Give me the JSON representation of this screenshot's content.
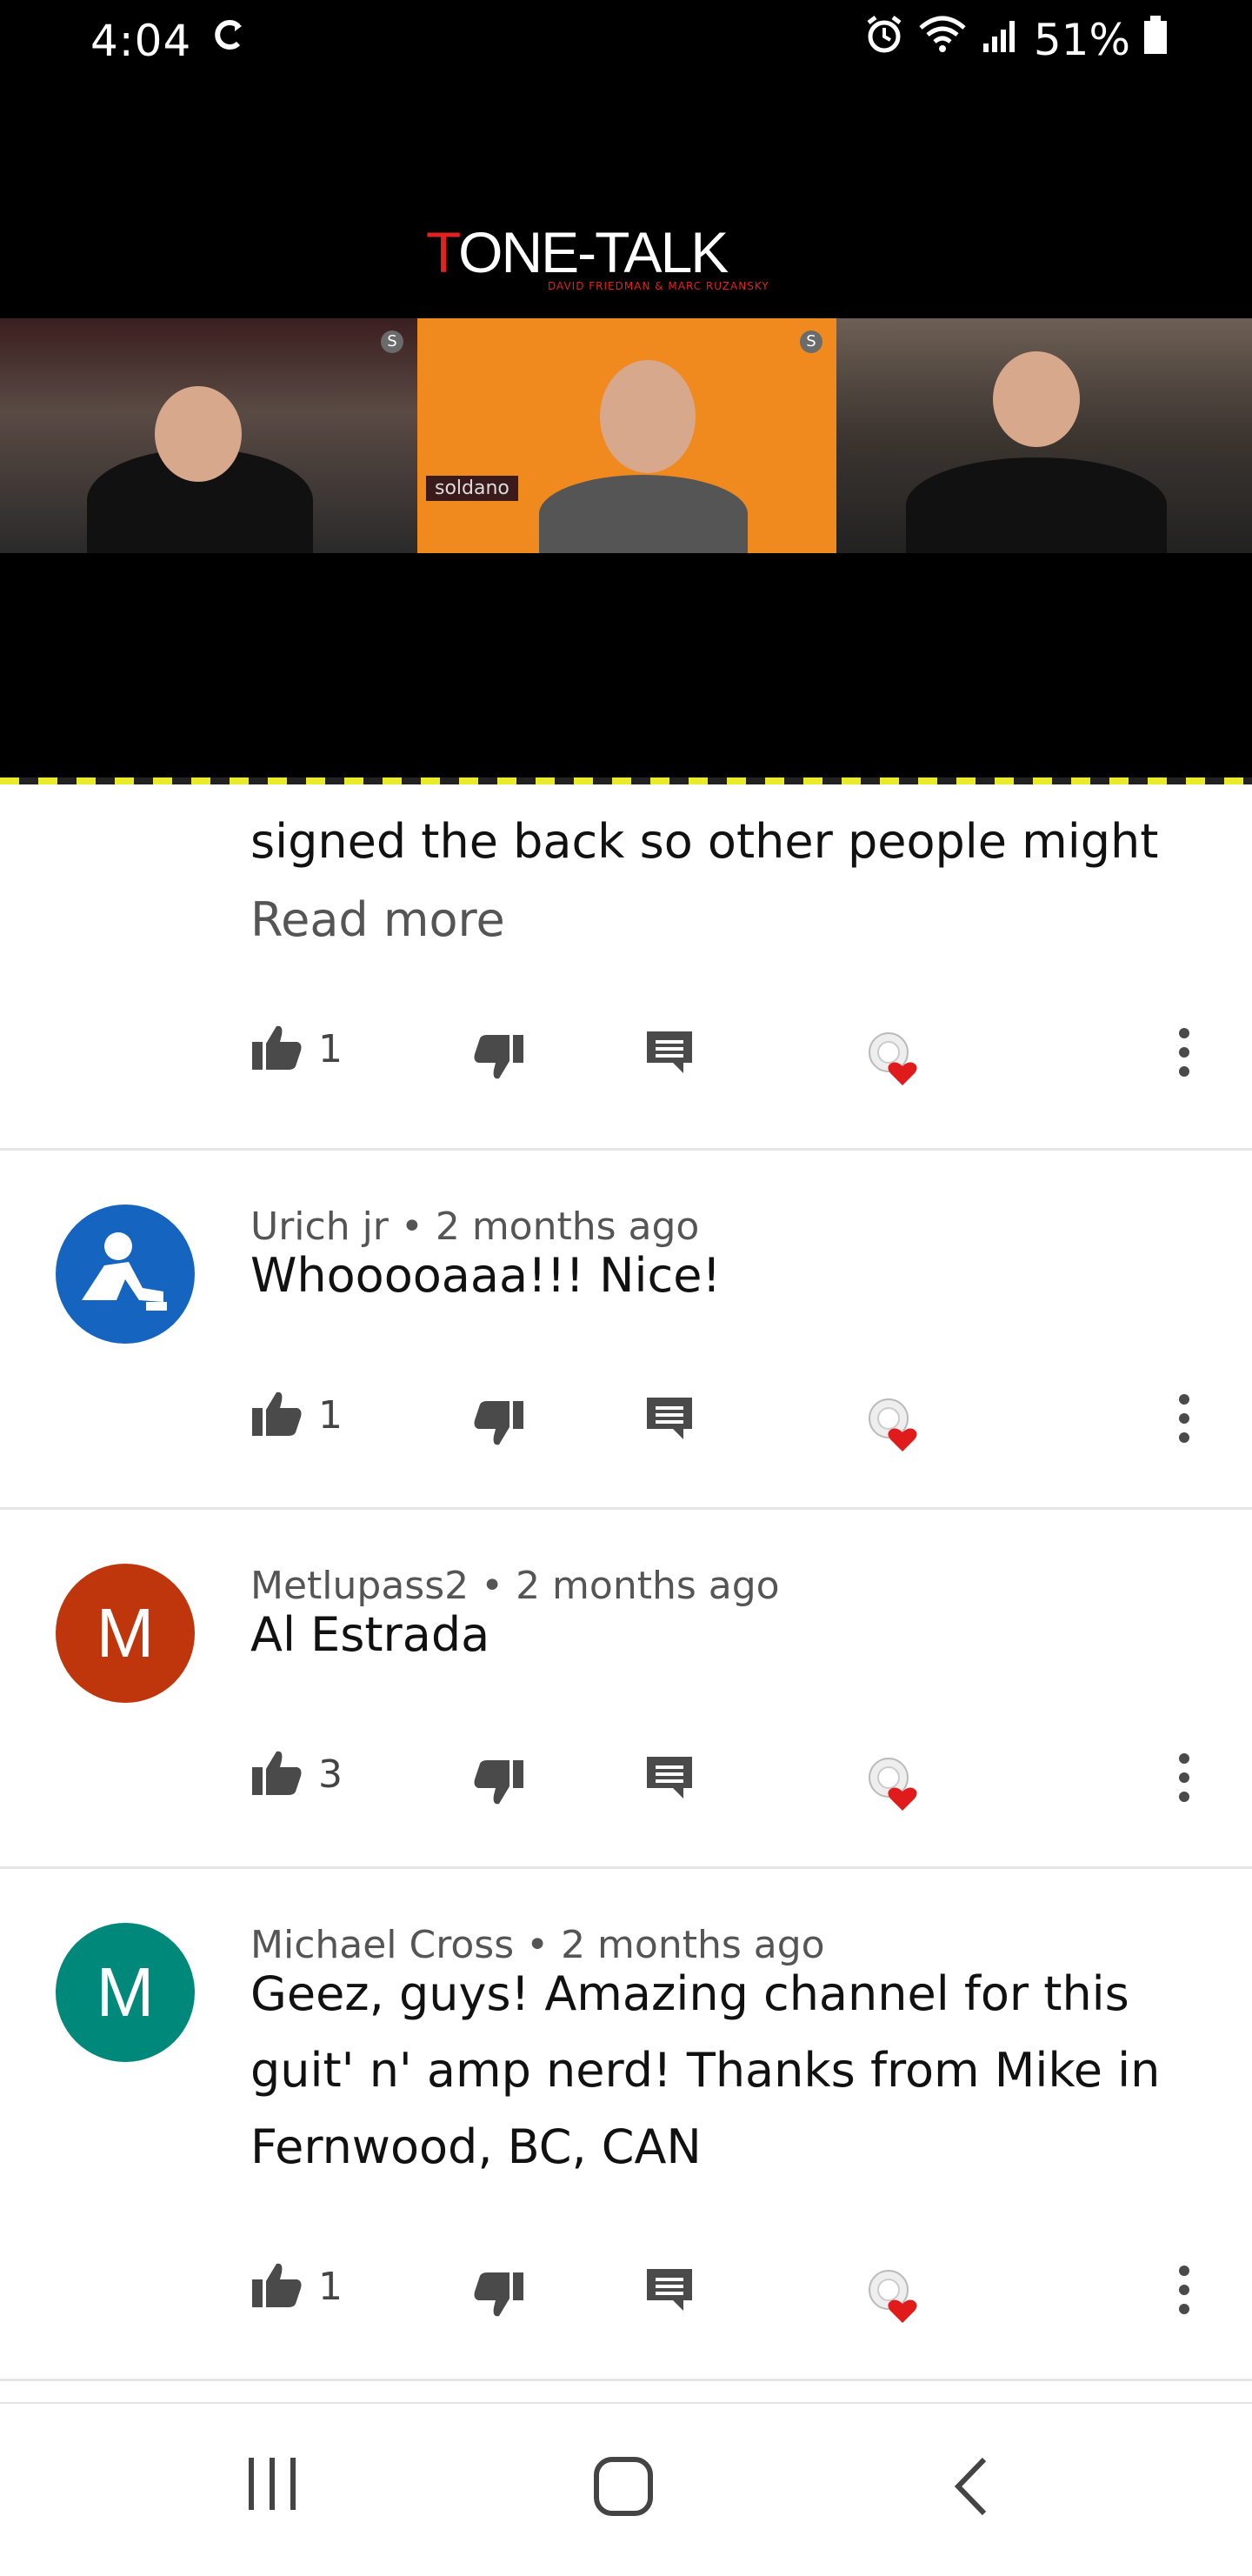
{
  "status": {
    "time": "4:04",
    "sync_glyph": "C",
    "battery": "51%"
  },
  "video": {
    "logo_title_t": "T",
    "logo_title_rest": "ONE-TALK",
    "logo_sub": "DAVID FRIEDMAN & MARC RUZANSKY",
    "amp_label": "soldano"
  },
  "comments": [
    {
      "text": "signed the back so other people might",
      "read_more": "Read more",
      "likes": "1"
    },
    {
      "author": "Urich jr",
      "age": "2 months ago",
      "text": "Whooooaaa!!! Nice!",
      "likes": "1",
      "avatar_color": "#1565c0"
    },
    {
      "author": "Metlupass2",
      "age": "2 months ago",
      "text": "Al Estrada",
      "likes": "3",
      "avatar_letter": "M",
      "avatar_color": "#bf360c"
    },
    {
      "author": "Michael Cross",
      "age": "2 months ago",
      "text_lines": [
        "Geez, guys! Amazing channel for this",
        "guit' n' amp nerd! Thanks from Mike in",
        "Fernwood, BC, CAN"
      ],
      "likes": "1",
      "avatar_letter": "M",
      "avatar_color": "#00897b"
    }
  ],
  "separator": " • ",
  "icons": [
    "thumbs-up-icon",
    "thumbs-down-icon",
    "reply-icon",
    "creator-heart-icon",
    "more-vert-icon",
    "recent-apps-icon",
    "home-icon",
    "back-icon"
  ]
}
